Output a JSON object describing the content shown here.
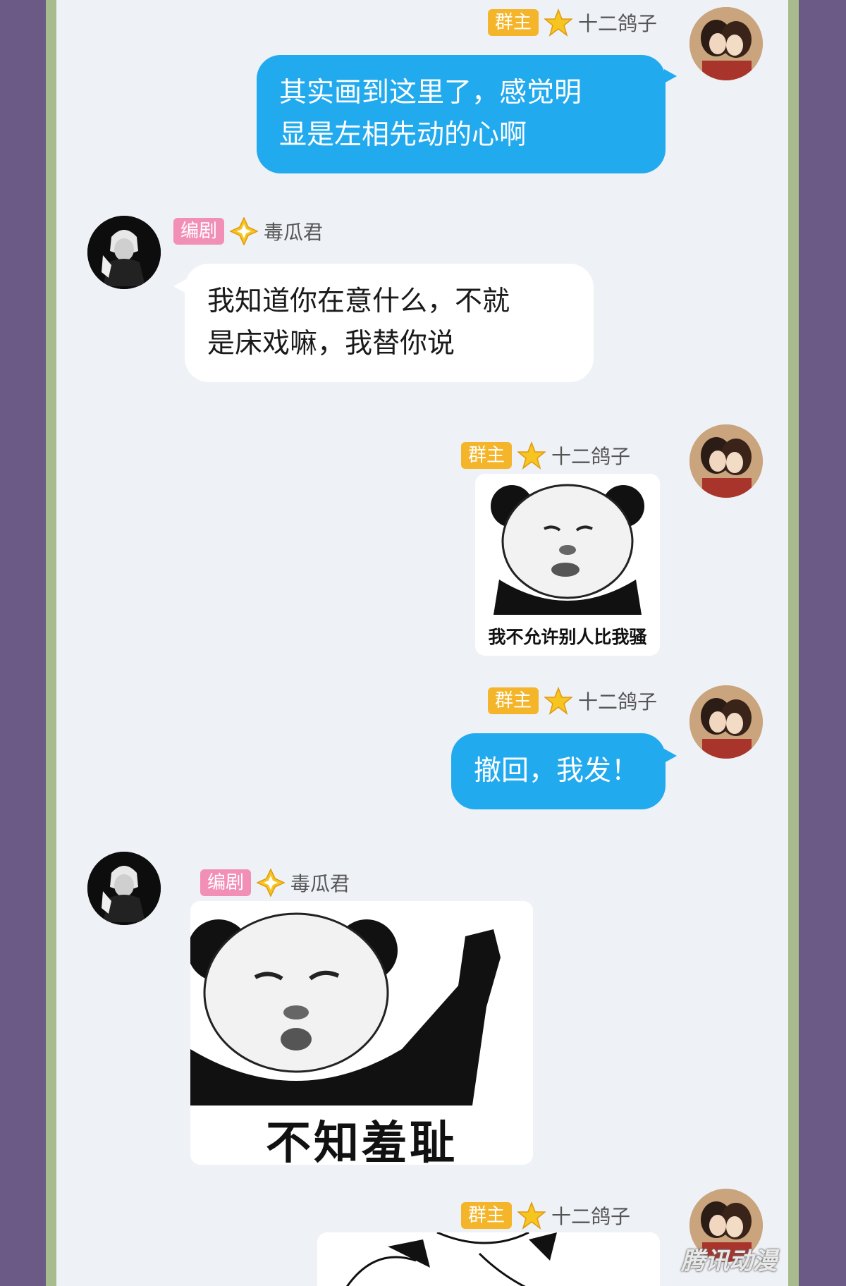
{
  "users": {
    "owner": {
      "badge": "群主",
      "name": "十二鸽子"
    },
    "writer": {
      "badge": "编剧",
      "name": "毒瓜君"
    }
  },
  "messages": [
    {
      "sender": "owner",
      "type": "text",
      "lines": [
        "其实画到这里了，感觉明",
        "显是左相先动的心啊"
      ]
    },
    {
      "sender": "writer",
      "type": "text",
      "lines": [
        "我知道你在意什么，不就",
        "是床戏嘛，我替你说"
      ]
    },
    {
      "sender": "owner",
      "type": "sticker",
      "caption": "我不允许别人比我骚"
    },
    {
      "sender": "owner",
      "type": "text",
      "lines": [
        "撤回，我发！"
      ]
    },
    {
      "sender": "writer",
      "type": "sticker",
      "caption": "不知羞耻"
    },
    {
      "sender": "owner",
      "type": "sticker",
      "caption": ""
    }
  ],
  "watermark": "腾讯动漫",
  "colors": {
    "background": "#6c5a86",
    "frame": "#a8bb8c",
    "panel": "#eef1f6",
    "bubble_blue": "#22aaef",
    "bubble_white": "#ffffff",
    "badge_owner": "#f4b52a",
    "badge_writer": "#f28fb6"
  }
}
